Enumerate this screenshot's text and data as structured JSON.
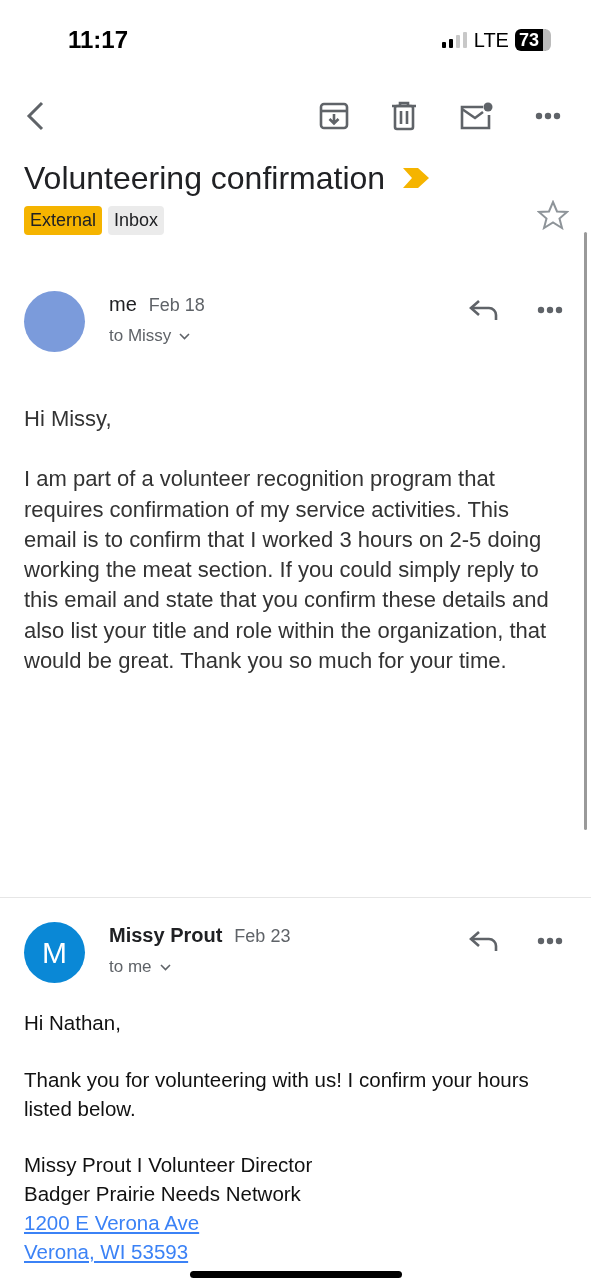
{
  "status_bar": {
    "time": "11:17",
    "network": "LTE",
    "battery": "73"
  },
  "subject": {
    "title": "Volunteering confirmation",
    "important": true,
    "starred": false,
    "labels": [
      {
        "text": "External",
        "kind": "external"
      },
      {
        "text": "Inbox",
        "kind": "system"
      }
    ]
  },
  "messages": [
    {
      "sender": "me",
      "date": "Feb 18",
      "recipient": "to Missy",
      "avatar": {
        "kind": "photo"
      },
      "blocks": [
        {
          "kind": "paragraph",
          "text": "Hi Missy,"
        },
        {
          "kind": "paragraph",
          "text": "I am part of a volunteer recognition program that requires confirmation of my service activities. This email is to confirm that I worked 3 hours on 2-5 doing working the meat section. If you could simply reply to this email and state that you confirm these details and also list your title and role within the organization, that would be great. Thank you so much for your time."
        }
      ]
    },
    {
      "sender": "Missy Prout",
      "date": "Feb 23",
      "recipient": "to me",
      "avatar": {
        "kind": "initial",
        "initial": "M"
      },
      "blocks": [
        {
          "kind": "paragraph",
          "text": "Hi Nathan,"
        },
        {
          "kind": "paragraph",
          "text": "Thank you for volunteering with us! I confirm your hours listed below."
        },
        {
          "kind": "signature",
          "lines": [
            {
              "kind": "text",
              "text": "Missy Prout I Volunteer Director"
            },
            {
              "kind": "text",
              "text": "Badger Prairie Needs Network"
            },
            {
              "kind": "link",
              "text": "1200 E Verona Ave"
            },
            {
              "kind": "link",
              "text": "Verona, WI 53593"
            }
          ]
        }
      ]
    }
  ]
}
